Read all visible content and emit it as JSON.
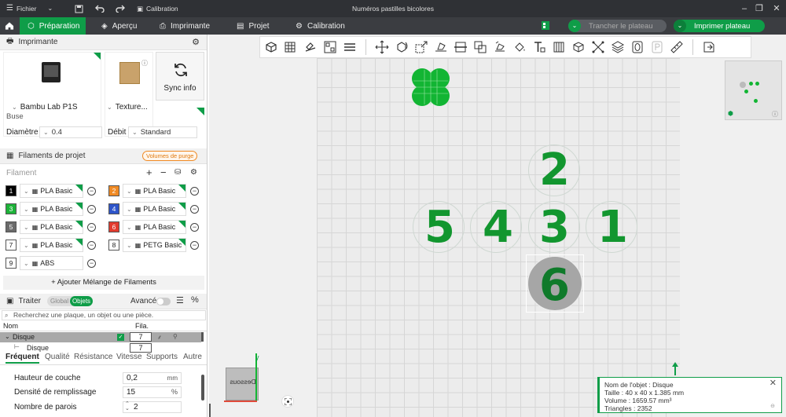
{
  "titlebar": {
    "menu_label": "Fichier",
    "calibration_label": "Calibration",
    "window_title": "Numéros pastilles bicolores"
  },
  "navbar": {
    "tabs": [
      {
        "label": "Préparation",
        "icon": "cube-icon"
      },
      {
        "label": "Aperçu",
        "icon": "layers-icon"
      },
      {
        "label": "Imprimante",
        "icon": "printer-icon"
      },
      {
        "label": "Projet",
        "icon": "project-icon"
      },
      {
        "label": "Calibration",
        "icon": "calibration-icon"
      }
    ],
    "slice_button": "Trancher le plateau",
    "print_button": "Imprimer plateau"
  },
  "printer": {
    "section_title": "Imprimante",
    "printer_name": "Bambu Lab P1S",
    "plate_texture": "Texture...",
    "sync_label": "Sync info",
    "nozzle_label": "Buse",
    "diameter_label": "Diamètre",
    "diameter_value": "0.4",
    "flow_label": "Débit",
    "flow_value": "Standard"
  },
  "filaments": {
    "section_title": "Filaments de projet",
    "purge_badge": "Volumes de purge",
    "filament_label": "Filament",
    "add_mix_label": "+ Ajouter Mélange de Filaments",
    "items": [
      {
        "num": "1",
        "color": "#000000",
        "type": "PLA Basic"
      },
      {
        "num": "2",
        "color": "#f08a24",
        "type": "PLA Basic"
      },
      {
        "num": "3",
        "color": "#1db339",
        "type": "PLA Basic"
      },
      {
        "num": "4",
        "color": "#2e55c9",
        "type": "PLA Basic"
      },
      {
        "num": "5",
        "color": "#6a6a6a",
        "type": "PLA Basic"
      },
      {
        "num": "6",
        "color": "#e23b2e",
        "type": "PLA Basic"
      },
      {
        "num": "7",
        "color": "#ffffff",
        "type": "PLA Basic"
      },
      {
        "num": "8",
        "color": "#ffffff",
        "type": "PETG Basic"
      },
      {
        "num": "9",
        "color": "#ffffff",
        "type": "ABS"
      }
    ]
  },
  "process": {
    "section_title": "Traiter",
    "toggle_global": "Global",
    "toggle_objects": "Objets",
    "advanced_label": "Avancé",
    "search_placeholder": "Recherchez une plaque, un objet ou une pièce.",
    "col_name": "Nom",
    "col_fila": "Fila.",
    "rows": [
      {
        "name": "Disque",
        "fila": "7"
      },
      {
        "name": "Disque",
        "fila": "7"
      }
    ],
    "tabs": [
      "Fréquent",
      "Qualité",
      "Résistance",
      "Vitesse",
      "Supports",
      "Autre"
    ],
    "params": [
      {
        "label": "Hauteur de couche",
        "value": "0,2",
        "unit": "mm"
      },
      {
        "label": "Densité de remplissage",
        "value": "15",
        "unit": "%"
      },
      {
        "label": "Nombre de parois",
        "value": "2",
        "unit": ""
      }
    ]
  },
  "canvas": {
    "digits": [
      "2",
      "5",
      "4",
      "3",
      "1",
      "6"
    ],
    "axis_y_label": "y",
    "view_cube_label": "Dessous",
    "object_info": {
      "name": "Nom de l'objet : Disque",
      "size": "Taille : 40 x 40 x 1.385 mm",
      "volume": "Volume : 1659.57 mm³",
      "triangles": "Triangles : 2352"
    }
  },
  "colors": {
    "accent": "#0f9d48",
    "digit_green": "#12962f"
  }
}
